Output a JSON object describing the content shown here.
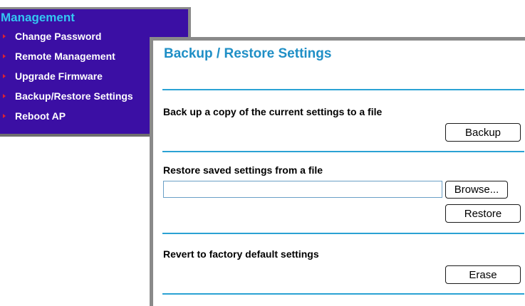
{
  "menu": {
    "title": "Management",
    "items": [
      {
        "label": "Change Password"
      },
      {
        "label": "Remote Management"
      },
      {
        "label": "Upgrade Firmware"
      },
      {
        "label": "Backup/Restore Settings"
      },
      {
        "label": "Reboot AP"
      }
    ]
  },
  "panel": {
    "title": "Backup / Restore Settings",
    "backup": {
      "label": "Back up a copy of the current settings to a file",
      "button": "Backup"
    },
    "restore": {
      "label": "Restore saved settings from a file",
      "file_value": "",
      "browse_button": "Browse...",
      "restore_button": "Restore"
    },
    "revert": {
      "label": "Revert to factory default settings",
      "button": "Erase"
    }
  },
  "colors": {
    "menu_background": "#3b0fa4",
    "menu_title": "#33c7f2",
    "menu_bullet": "#e0222d",
    "panel_title": "#1f8fc6",
    "divider": "#2aa2d4"
  }
}
